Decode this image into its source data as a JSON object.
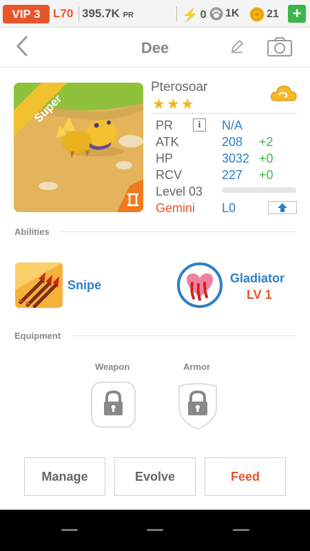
{
  "status_bar": {
    "vip": "VIP 3",
    "level": "L70",
    "pr_value": "395.7K",
    "pr_unit": "PR",
    "energy": "0",
    "paw": "1K",
    "coins": "21",
    "add": "+"
  },
  "header": {
    "title": "Dee"
  },
  "pet": {
    "rarity": "Super",
    "species": "Pterosoar",
    "stars": "★★★",
    "stats": [
      {
        "label": "PR",
        "value": "N/A",
        "bonus": ""
      },
      {
        "label": "ATK",
        "value": "208",
        "bonus": "+2"
      },
      {
        "label": "HP",
        "value": "3032",
        "bonus": "+0"
      },
      {
        "label": "RCV",
        "value": "227",
        "bonus": "+0"
      }
    ],
    "info_glyph": "i",
    "level_label": "Level 03",
    "level_progress": 0,
    "zodiac": "Gemini",
    "zodiac_level": "L0"
  },
  "abilities": {
    "section_label": "Abilities",
    "items": [
      {
        "name": "Snipe",
        "level": ""
      },
      {
        "name": "Gladiator",
        "level": "LV 1"
      }
    ]
  },
  "equipment": {
    "section_label": "Equipment",
    "weapon_label": "Weapon",
    "armor_label": "Armor"
  },
  "actions": {
    "manage": "Manage",
    "evolve": "Evolve",
    "feed": "Feed"
  },
  "colors": {
    "accent_orange": "#e8552a",
    "accent_blue": "#2c7fc9",
    "accent_green": "#3cb54a"
  }
}
